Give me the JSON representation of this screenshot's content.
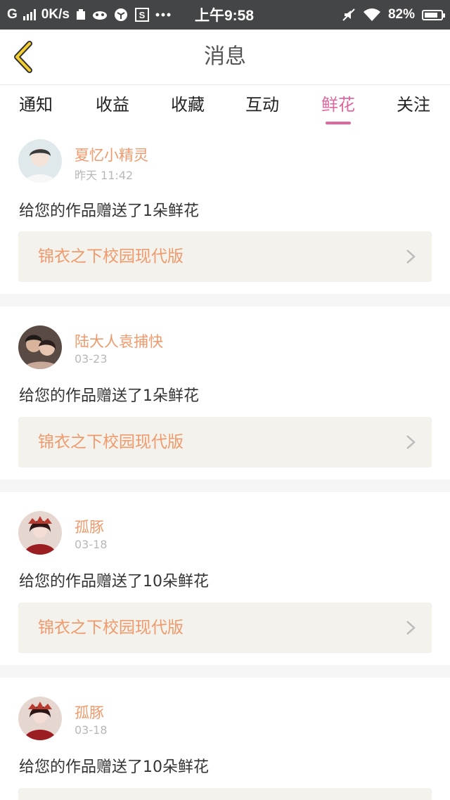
{
  "status_bar": {
    "carrier": "G",
    "net_speed": "0K/s",
    "time": "上午9:58",
    "battery": "82%",
    "battery_level": 0.82
  },
  "header": {
    "title": "消息"
  },
  "tabs": [
    {
      "label": "通知"
    },
    {
      "label": "收益"
    },
    {
      "label": "收藏"
    },
    {
      "label": "互动"
    },
    {
      "label": "鲜花",
      "active": true
    },
    {
      "label": "关注"
    }
  ],
  "colors": {
    "accent": "#e0679e",
    "username": "#ef9a6c",
    "work_bg": "#f4f2ec",
    "status_bar": "#444546"
  },
  "messages": [
    {
      "username": "夏忆小精灵",
      "time": "昨天 11:42",
      "text": "给您的作品赠送了1朵鲜花",
      "work": "锦衣之下校园现代版"
    },
    {
      "username": "陆大人袁捕快",
      "time": "03-23",
      "text": "给您的作品赠送了1朵鲜花",
      "work": "锦衣之下校园现代版"
    },
    {
      "username": "孤豚",
      "time": "03-18",
      "text": "给您的作品赠送了10朵鲜花",
      "work": "锦衣之下校园现代版"
    },
    {
      "username": "孤豚",
      "time": "03-18",
      "text": "给您的作品赠送了10朵鲜花",
      "work": ""
    }
  ]
}
